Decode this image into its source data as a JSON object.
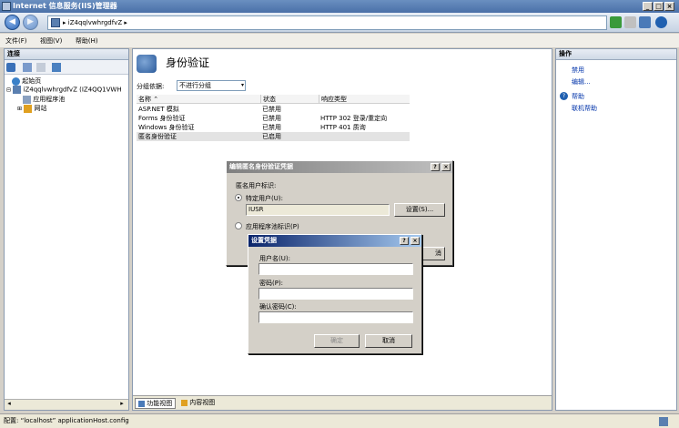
{
  "window": {
    "title": "Internet 信息服务(IIS)管理器"
  },
  "address": {
    "path": "iZ4qqlvwhrgdfvZ",
    "sep1": "▸",
    "sep2": "▸"
  },
  "menu": [
    "文件(F)",
    "视图(V)",
    "帮助(H)"
  ],
  "connections": {
    "title": "连接",
    "tree": [
      "起始页",
      "iZ4qqlvwhrgdfvZ (IZ4QQ1VWH",
      "应用程序池",
      "网站"
    ]
  },
  "main": {
    "title": "身份验证",
    "group_label": "分组依据:",
    "group_value": "不进行分组",
    "columns": [
      "名称 ⌃",
      "状态",
      "响应类型"
    ],
    "rows": [
      {
        "name": "ASP.NET 模拟",
        "status": "已禁用",
        "type": ""
      },
      {
        "name": "Forms 身份验证",
        "status": "已禁用",
        "type": "HTTP 302 登录/重定向"
      },
      {
        "name": "Windows 身份验证",
        "status": "已禁用",
        "type": "HTTP 401 质询"
      },
      {
        "name": "匿名身份验证",
        "status": "已启用",
        "type": ""
      }
    ],
    "tabs": [
      "功能视图",
      "内容视图"
    ]
  },
  "actions": {
    "title": "操作",
    "items": [
      "禁用",
      "编辑...",
      "帮助",
      "联机帮助"
    ]
  },
  "status": {
    "text": "配置: “localhost” applicationHost.config"
  },
  "dialog_edit": {
    "title": "编辑匿名身份验证凭据",
    "help": "?",
    "close": "×",
    "identity_label": "匿名用户标识:",
    "specific_user": "特定用户(U):",
    "user_value": "IUSR",
    "set_button": "设置(S)...",
    "pool_identity": "应用程序池标识(P)",
    "cancel_partial": "消"
  },
  "dialog_cred": {
    "title": "设置凭据",
    "help": "?",
    "close": "×",
    "username_label": "用户名(U):",
    "password_label": "密码(P):",
    "confirm_label": "确认密码(C):",
    "ok": "确定",
    "cancel": "取消"
  },
  "colors": {
    "accent": "#0a246a",
    "link": "#0033aa"
  }
}
